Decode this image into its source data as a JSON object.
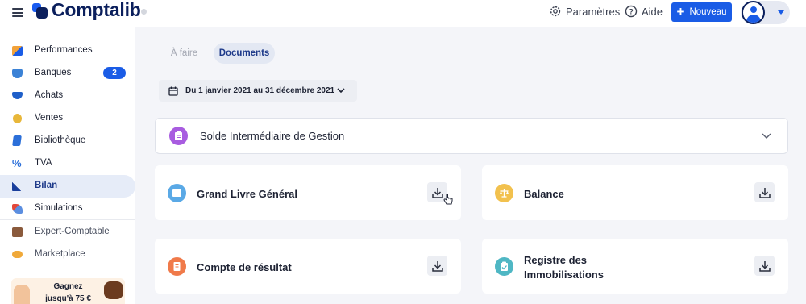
{
  "header": {
    "brand": "Comptalib",
    "settings_label": "Paramètres",
    "help_label": "Aide",
    "new_button_label": "Nouveau",
    "accent": "#1a5ce6"
  },
  "sidebar": {
    "items": [
      {
        "label": "Performances",
        "icon": "chart-icon"
      },
      {
        "label": "Banques",
        "icon": "bank-icon",
        "badge": "2"
      },
      {
        "label": "Achats",
        "icon": "cart-icon"
      },
      {
        "label": "Ventes",
        "icon": "coins-icon"
      },
      {
        "label": "Bibliothèque",
        "icon": "book-icon"
      },
      {
        "label": "TVA",
        "icon": "percent-icon"
      },
      {
        "label": "Bilan",
        "icon": "ruler-icon",
        "active": true
      },
      {
        "label": "Simulations",
        "icon": "rocket-icon"
      },
      {
        "label": "Expert-Comptable",
        "icon": "briefcase-icon"
      },
      {
        "label": "Marketplace",
        "icon": "handshake-icon"
      }
    ],
    "promo": {
      "line1": "Gagnez",
      "line2": "jusqu'à 75 €"
    }
  },
  "tabs": [
    {
      "label": "À faire",
      "active": false
    },
    {
      "label": "Documents",
      "active": true
    }
  ],
  "date_range": "Du 1 janvier 2021 au 31 décembre 2021",
  "cards": {
    "sig": {
      "title": "Solde Intermédiaire de Gestion",
      "color": "#a85ce0"
    },
    "grand_livre": {
      "title": "Grand Livre Général",
      "color": "#5aa9e6"
    },
    "balance": {
      "title": "Balance",
      "color": "#f2c14e"
    },
    "resultat": {
      "title": "Compte de résultat",
      "color": "#f07a4a"
    },
    "registre": {
      "title_line1": "Registre des",
      "title_line2": "Immobilisations",
      "color": "#4fb7c4"
    }
  }
}
